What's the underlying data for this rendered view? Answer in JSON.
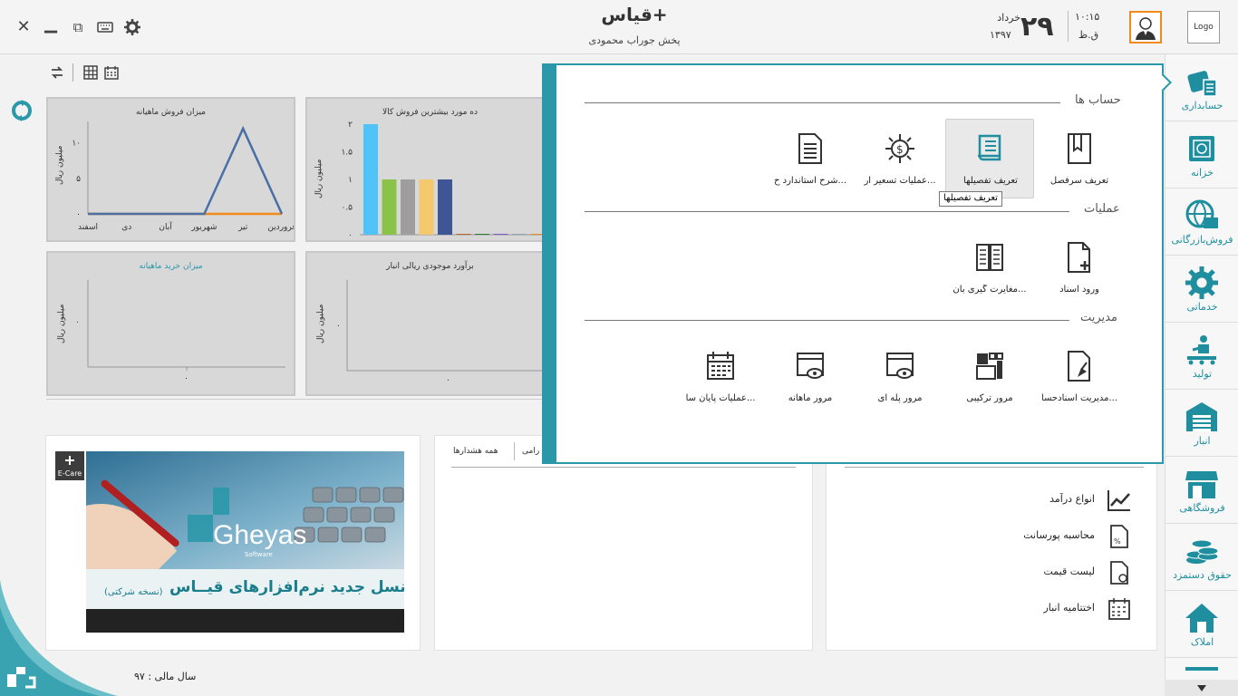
{
  "window": {
    "close_glyph": "✕",
    "minimize_glyph": "▁",
    "restore_glyph": "⧉"
  },
  "header": {
    "title": "قیاس+",
    "subtitle": "پخش جوراب محمودی",
    "date_day": "۲۹",
    "date_month": "خرداد",
    "date_year": "۱۳۹۷",
    "time": "۱۰:۱۵",
    "ampm": "ق.ظ",
    "logo_text": "Logo"
  },
  "charts": [
    {
      "title": "میزان فروش ماهیانه",
      "ylabel": "میلیون ریال",
      "chart_data": {
        "type": "line",
        "categories": [
          "فروردین",
          "تیر",
          "شهریور",
          "آبان",
          "دی",
          "اسفند"
        ],
        "series": [
          {
            "values": [
              0,
              12,
              0,
              0,
              0,
              0
            ],
            "color": "#4a6fa5"
          },
          {
            "values": [
              0,
              0,
              0,
              0,
              0,
              0
            ],
            "color": "#f28b1d"
          }
        ],
        "yticks": [
          "۰",
          "۵",
          "۱۰"
        ],
        "ylim": [
          0,
          13
        ]
      }
    },
    {
      "title": "ده مورد بیشترین فروش کالا",
      "ylabel": "میلیون ریال",
      "chart_data": {
        "type": "bar",
        "values": [
          2,
          1,
          1,
          1,
          1,
          0,
          0,
          0,
          0,
          0
        ],
        "colors": [
          "#4fc3f7",
          "#8bc34a",
          "#9e9e9e",
          "#f5c96b",
          "#3f5696",
          "#b46a2a",
          "#2e7d32",
          "#7e57c2",
          "#90a4ae",
          "#f28b1d"
        ],
        "yticks": [
          "۰",
          "۰.۵",
          "۱",
          "۱.۵",
          "۲"
        ],
        "ylim": [
          0,
          2
        ]
      }
    },
    {
      "title": "میزان خرید ماهیانه",
      "ylabel": "میلیون ریال",
      "ytick": "۰",
      "xtick": "۰"
    },
    {
      "title": "برآورد موجودی ریالی انبار",
      "ylabel": "میلیون ریال",
      "ytick": "۰",
      "xtick": "۰"
    }
  ],
  "messages_panel": {
    "tab_all_alerts": "همه هشدارها",
    "tab_partial": "رامی"
  },
  "shortcuts": [
    {
      "label": "انواع درآمد",
      "icon": "trend-chart-icon"
    },
    {
      "label": "محاسبه پورسانت",
      "icon": "percent-doc-icon"
    },
    {
      "label": "لیست قیمت",
      "icon": "price-doc-icon"
    },
    {
      "label": "اختتامیه انبار",
      "icon": "calendar-icon"
    }
  ],
  "sidebar": [
    {
      "label": "حسابداری",
      "icon": "accounting-icon"
    },
    {
      "label": "خزانه",
      "icon": "safe-icon"
    },
    {
      "label": "فروش‌بازرگانی",
      "icon": "globe-cart-icon"
    },
    {
      "label": "خدماتی",
      "icon": "gear-service-icon"
    },
    {
      "label": "تولید",
      "icon": "production-icon"
    },
    {
      "label": "انبار",
      "icon": "warehouse-icon"
    },
    {
      "label": "فروشگاهی",
      "icon": "store-icon"
    },
    {
      "label": "حقوق دستمزد",
      "icon": "coins-icon"
    },
    {
      "label": "املاک",
      "icon": "house-icon"
    }
  ],
  "popup": {
    "sections": [
      {
        "heading": "حساب ها",
        "items": [
          {
            "label": "تعریف سرفصل",
            "icon": "book-icon"
          },
          {
            "label": "تعریف تفصیلها",
            "icon": "detail-doc-icon",
            "active": true
          },
          {
            "label": "عملیات تسعیر ار...",
            "icon": "currency-gear-icon"
          },
          {
            "label": "شرح استاندارد ح...",
            "icon": "text-doc-icon"
          }
        ]
      },
      {
        "heading": "عملیات",
        "items": [
          {
            "label": "ورود اسناد",
            "icon": "add-doc-icon"
          },
          {
            "label": "مغایرت گیری بان...",
            "icon": "bank-reconcile-icon"
          }
        ]
      },
      {
        "heading": "مدیریت",
        "items": [
          {
            "label": "مدیریت اسنادحسا...",
            "icon": "doc-manage-icon"
          },
          {
            "label": "مرور ترکیبی",
            "icon": "combined-view-icon"
          },
          {
            "label": "مرور پله ای",
            "icon": "step-view-icon"
          },
          {
            "label": "مرور ماهانه",
            "icon": "monthly-view-icon"
          },
          {
            "label": "عملیات پایان سا...",
            "icon": "year-end-icon"
          }
        ]
      }
    ],
    "tooltip": "تعریف تفصیلها"
  },
  "banner": {
    "brand": "Gheyas",
    "brand_sub": "Software",
    "tagline": "نسل جدید نرم‌افزارهای قیــاس",
    "tagline_note": "(نسخه شرکتی)",
    "ecare": "E-Care"
  },
  "footer": {
    "fiscal_year": "سال مالی : ۹۷"
  },
  "colors": {
    "accent": "#2a98a8",
    "sidebar_text": "#1f8fa0",
    "avatar_border": "#f28b1d"
  }
}
